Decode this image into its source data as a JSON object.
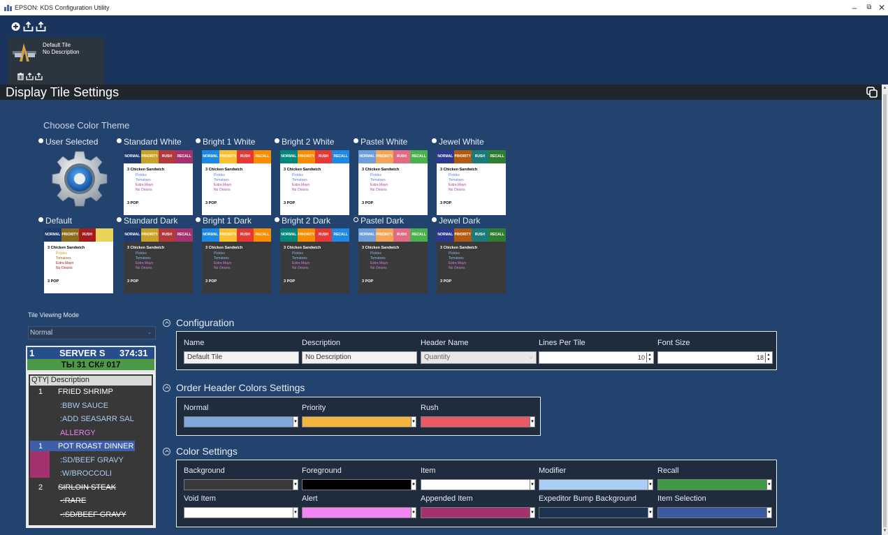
{
  "window": {
    "title": "EPSON: KDS Configuration Utility"
  },
  "tile": {
    "name": "Default Tile",
    "description": "No Description"
  },
  "section_title": "Display Tile Settings",
  "theme_section": {
    "label": "Choose Color Theme",
    "user_selected": "User Selected",
    "themes": [
      {
        "label": "Standard White",
        "selected": false,
        "headers": [
          "NORMAL",
          "PRIORITY",
          "RUSH",
          "RECALL"
        ]
      },
      {
        "label": "Bright 1 White",
        "selected": false,
        "headers": [
          "NORMAL",
          "PRIORITY",
          "RUSH",
          "RECALL"
        ]
      },
      {
        "label": "Bright 2 White",
        "selected": false,
        "headers": [
          "NORMAL",
          "PRIORITY",
          "RUSH",
          "RECALL"
        ]
      },
      {
        "label": "Pastel White",
        "selected": false,
        "headers": [
          "NORMAL",
          "PRIORITY",
          "RUSH",
          "RECALL"
        ]
      },
      {
        "label": "Jewel White",
        "selected": false,
        "headers": [
          "NORMAL",
          "PRIORITY",
          "RUSH",
          "RECALL"
        ]
      },
      {
        "label": "Default",
        "selected": false,
        "headers": [
          "NORMAL",
          "PRIORITY",
          "RUSH",
          "RECALL"
        ]
      },
      {
        "label": "Standard Dark",
        "selected": false,
        "headers": [
          "NORMAL",
          "PRIORITY",
          "RUSH",
          "RECALL"
        ]
      },
      {
        "label": "Bright 1 Dark",
        "selected": false,
        "headers": [
          "NORMAL",
          "PRIORITY",
          "RUSH",
          "RECALL"
        ]
      },
      {
        "label": "Bright 2 Dark",
        "selected": false,
        "headers": [
          "NORMAL",
          "PRIORITY",
          "RUSH",
          "RECALL"
        ]
      },
      {
        "label": "Pastel Dark",
        "selected": true,
        "headers": [
          "NORMAL",
          "PRIORITY",
          "RUSH",
          "RECALL"
        ]
      },
      {
        "label": "Jewel Dark",
        "selected": false,
        "headers": [
          "NORMAL",
          "PRIORITY",
          "RUSH",
          "RECALL"
        ]
      }
    ],
    "sample_order": {
      "qty": "3",
      "item": "Chicken Sandwich",
      "modifiers": [
        "Pickles",
        "Tomatoes",
        "Extra Mayo",
        "No Onions"
      ],
      "footer_qty": "3",
      "footer_item": "POP"
    }
  },
  "tile_viewing_mode": {
    "label": "Tile Viewing Mode",
    "value": "Normal"
  },
  "tile_preview": {
    "seat": "1",
    "server": "SERVER S",
    "time": "374:31",
    "check": "ТЫ 31 СК# 017",
    "col_qty": "QTY",
    "col_desc": "| Description",
    "items": [
      {
        "qty": "1",
        "name": "FRIED SHRIMP"
      },
      {
        "qty": "",
        "name": ":BBW SAUCE"
      },
      {
        "qty": "",
        "name": ":ADD SEASARR SAL"
      },
      {
        "qty": "",
        "name": "ALLERGY"
      },
      {
        "qty": "1",
        "name": "POT ROAST DINNER"
      },
      {
        "qty": "",
        "name": ":SD/BEEF GRAVY"
      },
      {
        "qty": "",
        "name": ":W/BROCCOLI"
      },
      {
        "qty": "2",
        "name": "SIRLOIN STEAK"
      },
      {
        "qty": "",
        "name": "-:RARE"
      },
      {
        "qty": "",
        "name": "-:SD/BEEF GRAVY"
      }
    ]
  },
  "configuration": {
    "title": "Configuration",
    "name_label": "Name",
    "name_value": "Default Tile",
    "description_label": "Description",
    "description_value": "No Description",
    "header_name_label": "Header Name",
    "header_name_value": "Quantity",
    "lines_per_tile_label": "Lines Per Tile",
    "lines_per_tile_value": "10",
    "font_size_label": "Font Size",
    "font_size_value": "18"
  },
  "order_header_colors": {
    "title": "Order Header Colors Settings",
    "normal_label": "Normal",
    "normal_color": "#7ea7db",
    "priority_label": "Priority",
    "priority_color": "#f3b53d",
    "rush_label": "Rush",
    "rush_color": "#e85a66"
  },
  "color_settings": {
    "title": "Color Settings",
    "fields": [
      {
        "label": "Background",
        "color": "#3a3a3a"
      },
      {
        "label": "Foreground",
        "color": "#000000"
      },
      {
        "label": "Item",
        "color": "#ffffff"
      },
      {
        "label": "Modifier",
        "color": "#a9cdf3"
      },
      {
        "label": "Recall",
        "color": "#3f9a46"
      },
      {
        "label": "Void Item",
        "color": "#ffffff"
      },
      {
        "label": "Alert",
        "color": "#f285f1"
      },
      {
        "label": "Appended Item",
        "color": "#a3326f"
      },
      {
        "label": "Expeditor Bump Background",
        "color": "#1d3352"
      },
      {
        "label": "Item Selection",
        "color": "#3b5aa2"
      }
    ]
  },
  "colors": {
    "window_bg": "#23436f",
    "top_bar": "#1b345d",
    "section_bar": "#20262c"
  }
}
